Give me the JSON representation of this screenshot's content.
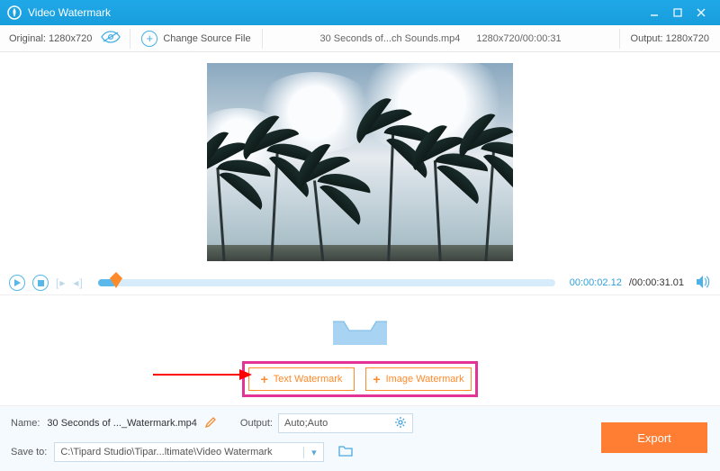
{
  "titlebar": {
    "title": "Video Watermark"
  },
  "toolbar": {
    "original_label": "Original: 1280x720",
    "change_label": "Change Source File",
    "filename": "30 Seconds of...ch Sounds.mp4",
    "file_meta": "1280x720/00:00:31",
    "output_label": "Output: 1280x720"
  },
  "player": {
    "current_time": "00:00:02.12",
    "total_time": "/00:00:31.01"
  },
  "watermark": {
    "text_btn": "Text Watermark",
    "image_btn": "Image Watermark"
  },
  "bottom": {
    "name_label": "Name:",
    "name_value": "30 Seconds of ..._Watermark.mp4",
    "output_label": "Output:",
    "output_value": "Auto;Auto",
    "save_label": "Save to:",
    "save_path": "C:\\Tipard Studio\\Tipar...ltimate\\Video Watermark",
    "export": "Export"
  },
  "colors": {
    "accent": "#189ddc",
    "orange": "#ff8a2a",
    "magenta": "#e43397"
  }
}
